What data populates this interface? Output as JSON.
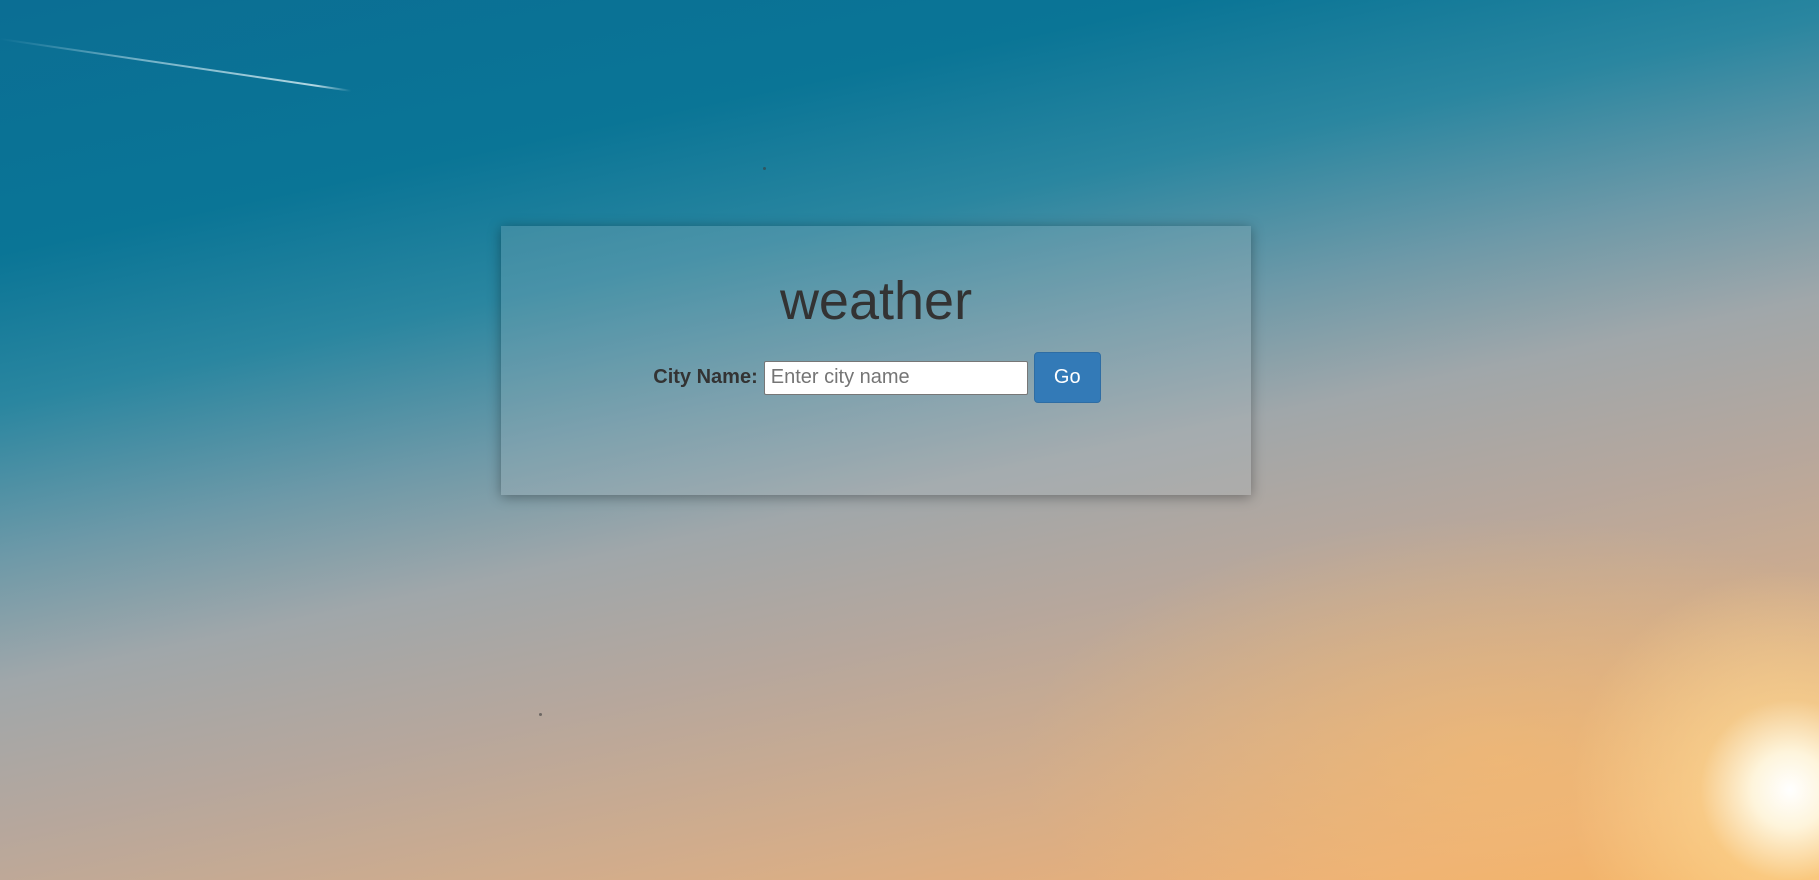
{
  "page": {
    "title": "weather"
  },
  "form": {
    "label": "City Name:",
    "input_value": "",
    "input_placeholder": "Enter city name",
    "button_label": "Go"
  },
  "colors": {
    "button_bg": "#337ab7",
    "text": "#333333"
  }
}
